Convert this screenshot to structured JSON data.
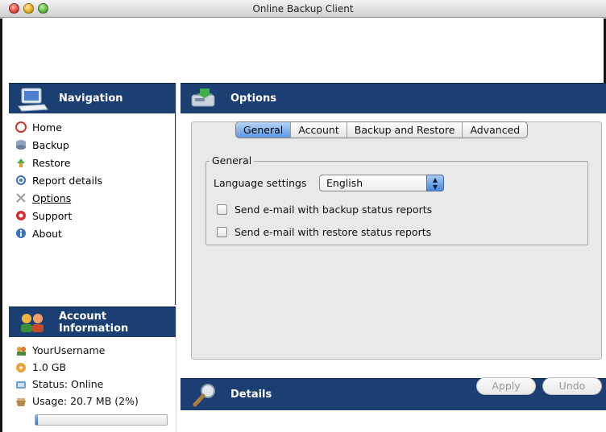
{
  "window": {
    "title": "Online Backup Client"
  },
  "navigation": {
    "header": "Navigation",
    "items": [
      {
        "label": "Home",
        "icon": "home-icon"
      },
      {
        "label": "Backup",
        "icon": "backup-icon"
      },
      {
        "label": "Restore",
        "icon": "restore-icon"
      },
      {
        "label": "Report details",
        "icon": "report-icon"
      },
      {
        "label": "Options",
        "icon": "options-icon",
        "active": true
      },
      {
        "label": "Support",
        "icon": "support-icon"
      },
      {
        "label": "About",
        "icon": "about-icon"
      }
    ]
  },
  "account": {
    "header": "Account Information",
    "username": "YourUsername",
    "quota": "1.0 GB",
    "status": "Status: Online",
    "usage": "Usage: 20.7 MB (2%)",
    "usage_percent": 2
  },
  "options": {
    "header": "Options",
    "tabs": [
      "General",
      "Account",
      "Backup and Restore",
      "Advanced"
    ],
    "selected_tab": "General",
    "group_title": "General",
    "language_label": "Language settings",
    "language_value": "English",
    "checkboxes": [
      {
        "label": "Send e-mail with backup status reports",
        "checked": false
      },
      {
        "label": "Send e-mail with restore status reports",
        "checked": false
      }
    ],
    "apply_label": "Apply",
    "undo_label": "Undo"
  },
  "details": {
    "header": "Details"
  },
  "colors": {
    "panel_header": "#1c3f73",
    "tab_selected": "#5d98e3"
  }
}
